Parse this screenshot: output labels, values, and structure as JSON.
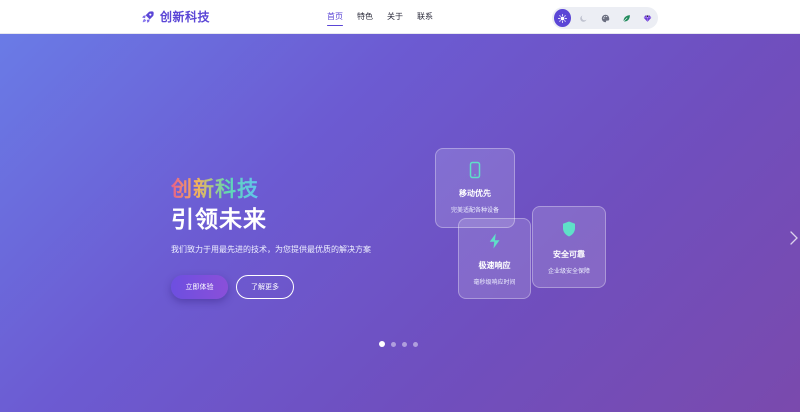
{
  "header": {
    "brand": "创新科技",
    "nav": [
      {
        "label": "首页",
        "active": true
      },
      {
        "label": "特色",
        "active": false
      },
      {
        "label": "关于",
        "active": false
      },
      {
        "label": "联系",
        "active": false
      }
    ],
    "theme_buttons": [
      {
        "icon": "sun-icon",
        "active": true
      },
      {
        "icon": "moon-icon",
        "active": false
      },
      {
        "icon": "palette-icon",
        "active": false
      },
      {
        "icon": "leaf-icon",
        "active": false
      },
      {
        "icon": "gem-icon",
        "active": false
      }
    ]
  },
  "hero": {
    "title_line1": "创新科技",
    "title_line2": "引领未来",
    "subtitle": "我们致力于用最先进的技术，为您提供最优质的解决方案",
    "primary_button": "立即体验",
    "secondary_button": "了解更多"
  },
  "features": [
    {
      "icon": "mobile-icon",
      "title": "移动优先",
      "desc": "完美适配各种设备"
    },
    {
      "icon": "bolt-icon",
      "title": "极速响应",
      "desc": "毫秒级响应时间"
    },
    {
      "icon": "shield-icon",
      "title": "安全可靠",
      "desc": "企业级安全保障"
    }
  ],
  "carousel": {
    "slides": 4,
    "active_index": 0
  },
  "colors": {
    "brand": "#5b46d6",
    "hero_gradient_start": "#6a7be6",
    "hero_gradient_end": "#7a4aad",
    "feature_icon": "#5fe0c8"
  }
}
